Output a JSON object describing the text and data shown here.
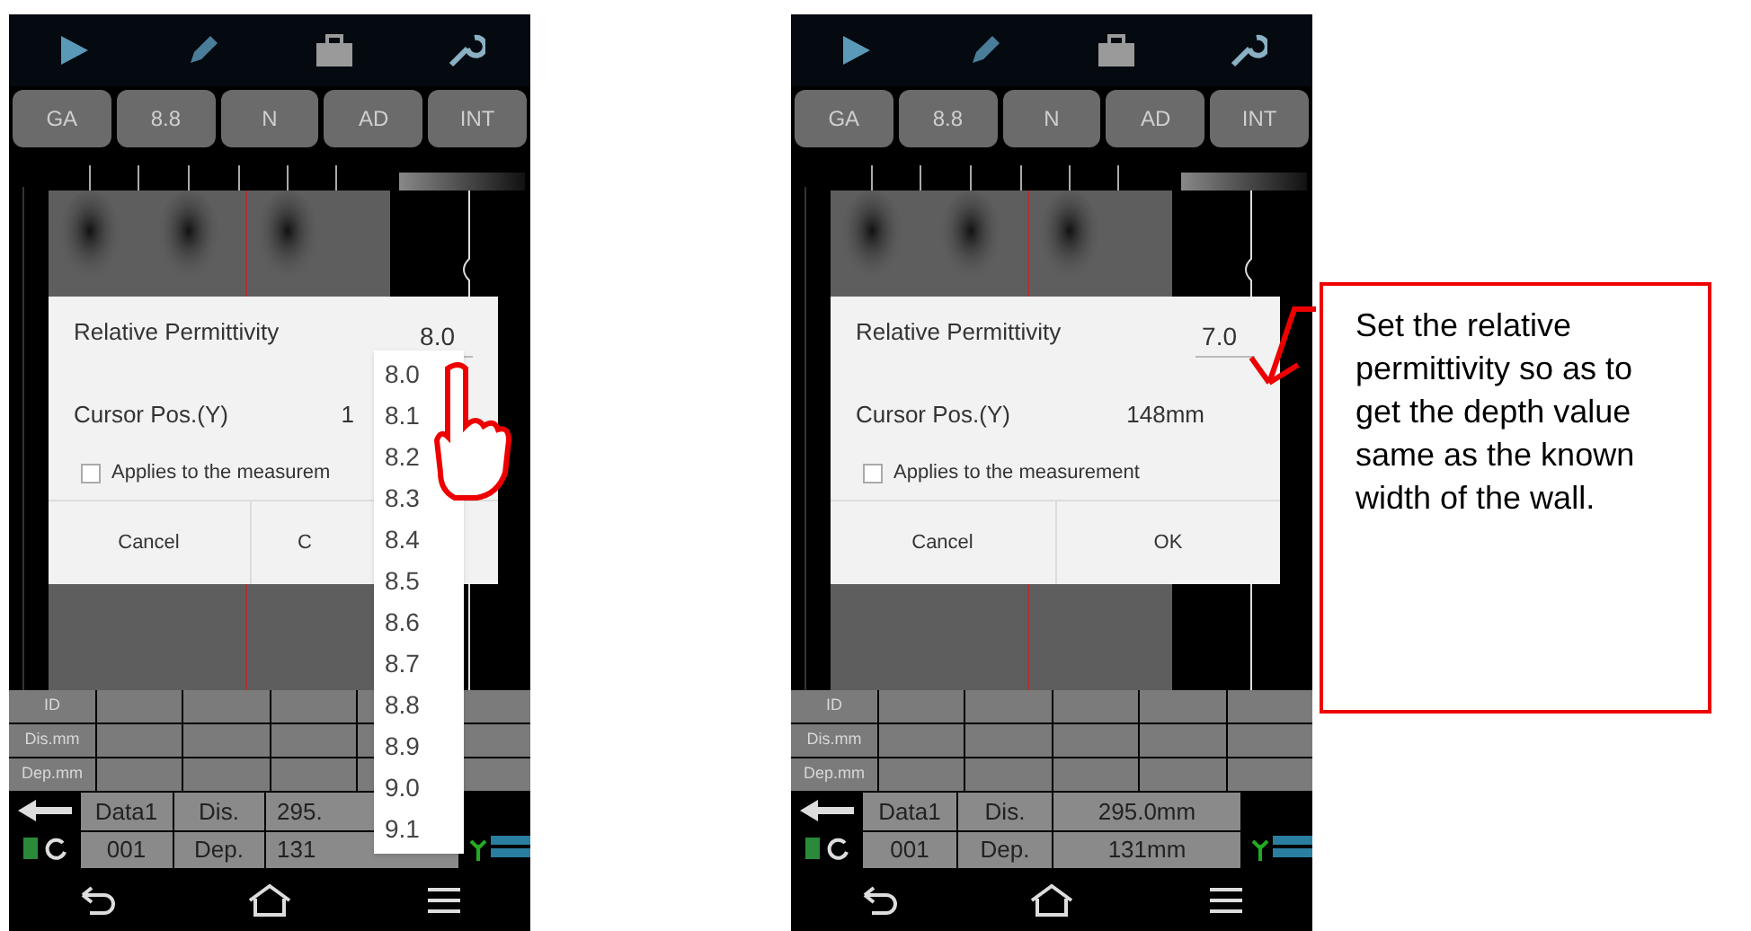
{
  "screens": [
    {
      "mode_buttons": [
        "GA",
        "8.8",
        "N",
        "AD",
        "INT"
      ],
      "table_rows": [
        "ID",
        "Dis.mm",
        "Dep.mm"
      ],
      "status_rows": [
        [
          "Data1",
          "Dis.",
          "295."
        ],
        [
          "001",
          "Dep.",
          "131"
        ]
      ],
      "dialog": {
        "title": "Relative Permittivity",
        "value": "8.0",
        "cursor_label": "Cursor Pos.(Y)",
        "cursor_value": "1",
        "checkbox": {
          "label": "Applies to the measurem",
          "checked": false
        },
        "buttons": [
          "Cancel",
          "C"
        ]
      },
      "dropdown": {
        "options": [
          "8.0",
          "8.1",
          "8.2",
          "8.3",
          "8.4",
          "8.5",
          "8.6",
          "8.7",
          "8.8",
          "8.9",
          "9.0",
          "9.1"
        ]
      },
      "annotation": {
        "kind": "hand"
      }
    },
    {
      "mode_buttons": [
        "GA",
        "8.8",
        "N",
        "AD",
        "INT"
      ],
      "table_rows": [
        "ID",
        "Dis.mm",
        "Dep.mm"
      ],
      "status_rows": [
        [
          "Data1",
          "Dis.",
          "295.0mm"
        ],
        [
          "001",
          "Dep.",
          "131mm"
        ]
      ],
      "dialog": {
        "title": "Relative Permittivity",
        "value": "7.0",
        "cursor_label": "Cursor Pos.(Y)",
        "cursor_value": "148mm",
        "checkbox": {
          "label": "Applies to the measurement",
          "checked": false
        },
        "buttons": [
          "Cancel",
          "OK"
        ]
      },
      "annotation": {
        "kind": "arrow"
      }
    }
  ],
  "callout": {
    "text": "Set the relative permittivity so as to get the depth value same as the known width of the wall."
  }
}
